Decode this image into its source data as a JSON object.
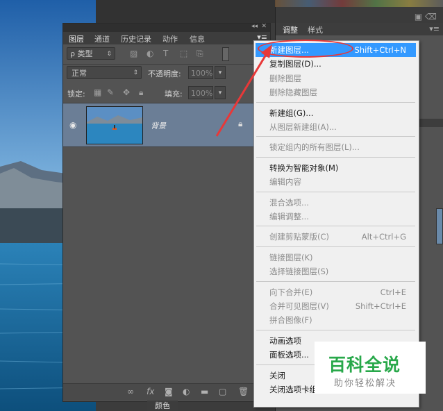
{
  "layers_panel": {
    "tabs": [
      {
        "label": "图层",
        "active": true
      },
      {
        "label": "通道",
        "active": false
      },
      {
        "label": "历史记录",
        "active": false
      },
      {
        "label": "动作",
        "active": false
      },
      {
        "label": "信息",
        "active": false
      }
    ],
    "filter": {
      "kind_label": "ρ 类型"
    },
    "blend_mode": "正常",
    "opacity_label": "不透明度:",
    "opacity_value": "100%",
    "lock_label": "锁定:",
    "fill_label": "填充:",
    "fill_value": "100%",
    "layers": [
      {
        "name": "背景",
        "visible": true,
        "locked": true,
        "selected": true
      }
    ]
  },
  "right_panel": {
    "tabs": [
      {
        "label": "调整",
        "active": true
      },
      {
        "label": "样式",
        "active": false
      }
    ]
  },
  "bottom_tab": {
    "label": "颜色"
  },
  "context_menu": {
    "items": [
      {
        "label": "新建图层...",
        "shortcut": "Shift+Ctrl+N",
        "enabled": true,
        "highlighted": true
      },
      {
        "label": "复制图层(D)...",
        "shortcut": "",
        "enabled": true
      },
      {
        "label": "删除图层",
        "shortcut": "",
        "enabled": false
      },
      {
        "label": "删除隐藏图层",
        "shortcut": "",
        "enabled": false
      },
      {
        "separator": true
      },
      {
        "label": "新建组(G)...",
        "shortcut": "",
        "enabled": true
      },
      {
        "label": "从图层新建组(A)...",
        "shortcut": "",
        "enabled": false
      },
      {
        "separator": true
      },
      {
        "label": "锁定组内的所有图层(L)...",
        "shortcut": "",
        "enabled": false
      },
      {
        "separator": true
      },
      {
        "label": "转换为智能对象(M)",
        "shortcut": "",
        "enabled": true
      },
      {
        "label": "编辑内容",
        "shortcut": "",
        "enabled": false
      },
      {
        "separator": true
      },
      {
        "label": "混合选项...",
        "shortcut": "",
        "enabled": false
      },
      {
        "label": "编辑调整...",
        "shortcut": "",
        "enabled": false
      },
      {
        "separator": true
      },
      {
        "label": "创建剪贴蒙版(C)",
        "shortcut": "Alt+Ctrl+G",
        "enabled": false
      },
      {
        "separator": true
      },
      {
        "label": "链接图层(K)",
        "shortcut": "",
        "enabled": false
      },
      {
        "label": "选择链接图层(S)",
        "shortcut": "",
        "enabled": false
      },
      {
        "separator": true
      },
      {
        "label": "向下合并(E)",
        "shortcut": "Ctrl+E",
        "enabled": false
      },
      {
        "label": "合并可见图层(V)",
        "shortcut": "Shift+Ctrl+E",
        "enabled": false
      },
      {
        "label": "拼合图像(F)",
        "shortcut": "",
        "enabled": false
      },
      {
        "separator": true
      },
      {
        "label": "动画选项",
        "shortcut": "",
        "enabled": true
      },
      {
        "label": "面板选项...",
        "shortcut": "",
        "enabled": true
      },
      {
        "separator": true
      },
      {
        "label": "关闭",
        "shortcut": "",
        "enabled": true
      },
      {
        "label": "关闭选项卡组",
        "shortcut": "",
        "enabled": true
      }
    ]
  },
  "watermark": {
    "main": "百科全说",
    "sub": "助你轻松解决"
  },
  "colors": {
    "highlight": "#3399ff",
    "annotation": "#e83838",
    "watermark_green": "#28a84a",
    "selected_layer": "#6b7e96"
  }
}
